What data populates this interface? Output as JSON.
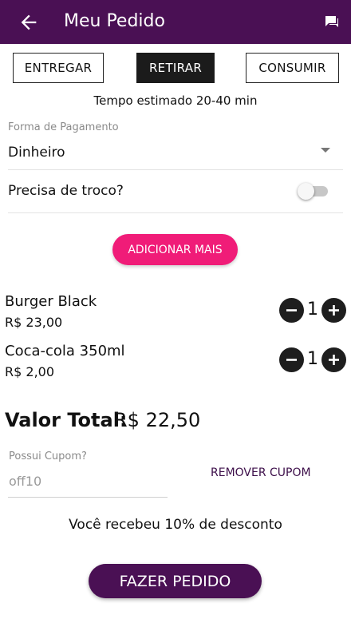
{
  "header": {
    "title": "Meu Pedido",
    "back_icon": "arrow-left-icon",
    "chat_icon": "chat-icon"
  },
  "modes": {
    "deliver": "ENTREGAR",
    "pickup": "RETIRAR",
    "consume": "CONSUMIR",
    "selected": "RETIRAR"
  },
  "eta": "Tempo estimado 20-40 min",
  "payment": {
    "label": "Forma de Pagamento",
    "value": "Dinheiro"
  },
  "change": {
    "label": "Precisa de troco?",
    "enabled": false
  },
  "add_more": "ADICIONAR MAIS",
  "items": [
    {
      "name": "Burger Black",
      "price": "R$ 23,00",
      "qty": "1"
    },
    {
      "name": "Coca-cola 350ml",
      "price": "R$ 2,00",
      "qty": "1"
    }
  ],
  "total": {
    "label": "Valor Total:",
    "value": "R$ 22,50"
  },
  "coupon": {
    "label": "Possui Cupom?",
    "value": "off10",
    "remove": "REMOVER CUPOM"
  },
  "discount_message": "Você recebeu 10% de desconto",
  "submit": "FAZER PEDIDO",
  "colors": {
    "primary": "#4a1054",
    "accent": "#f01c78"
  }
}
